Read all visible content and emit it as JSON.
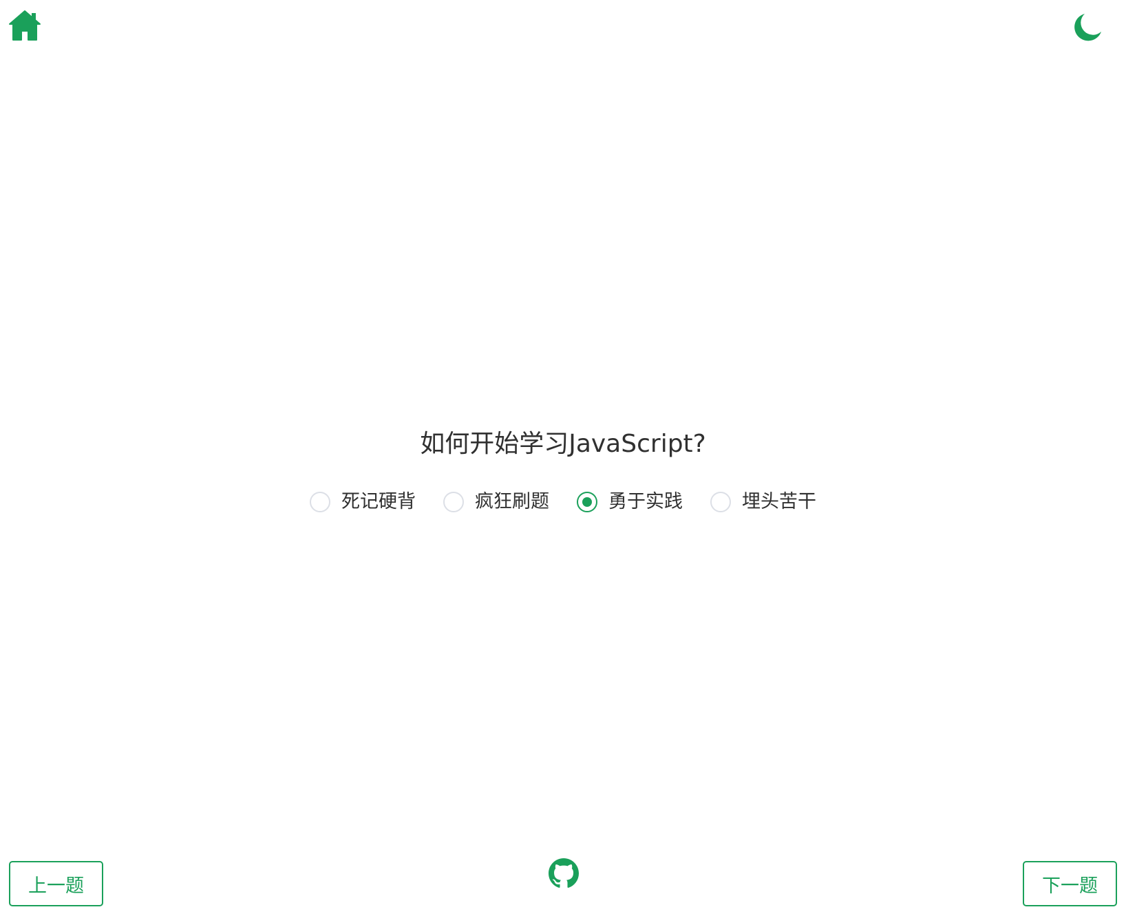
{
  "header": {
    "home_icon": "home-icon",
    "theme_icon": "moon-icon"
  },
  "quiz": {
    "question": "如何开始学习JavaScript?",
    "options": [
      {
        "label": "死记硬背",
        "checked": false
      },
      {
        "label": "疯狂刷题",
        "checked": false
      },
      {
        "label": "勇于实践",
        "checked": true
      },
      {
        "label": "埋头苦干",
        "checked": false
      }
    ]
  },
  "footer": {
    "prev_label": "上一题",
    "next_label": "下一题",
    "github_icon": "github-icon"
  },
  "colors": {
    "accent": "#1aa05a",
    "text": "#303030",
    "radio_border": "#dcdfe6"
  }
}
